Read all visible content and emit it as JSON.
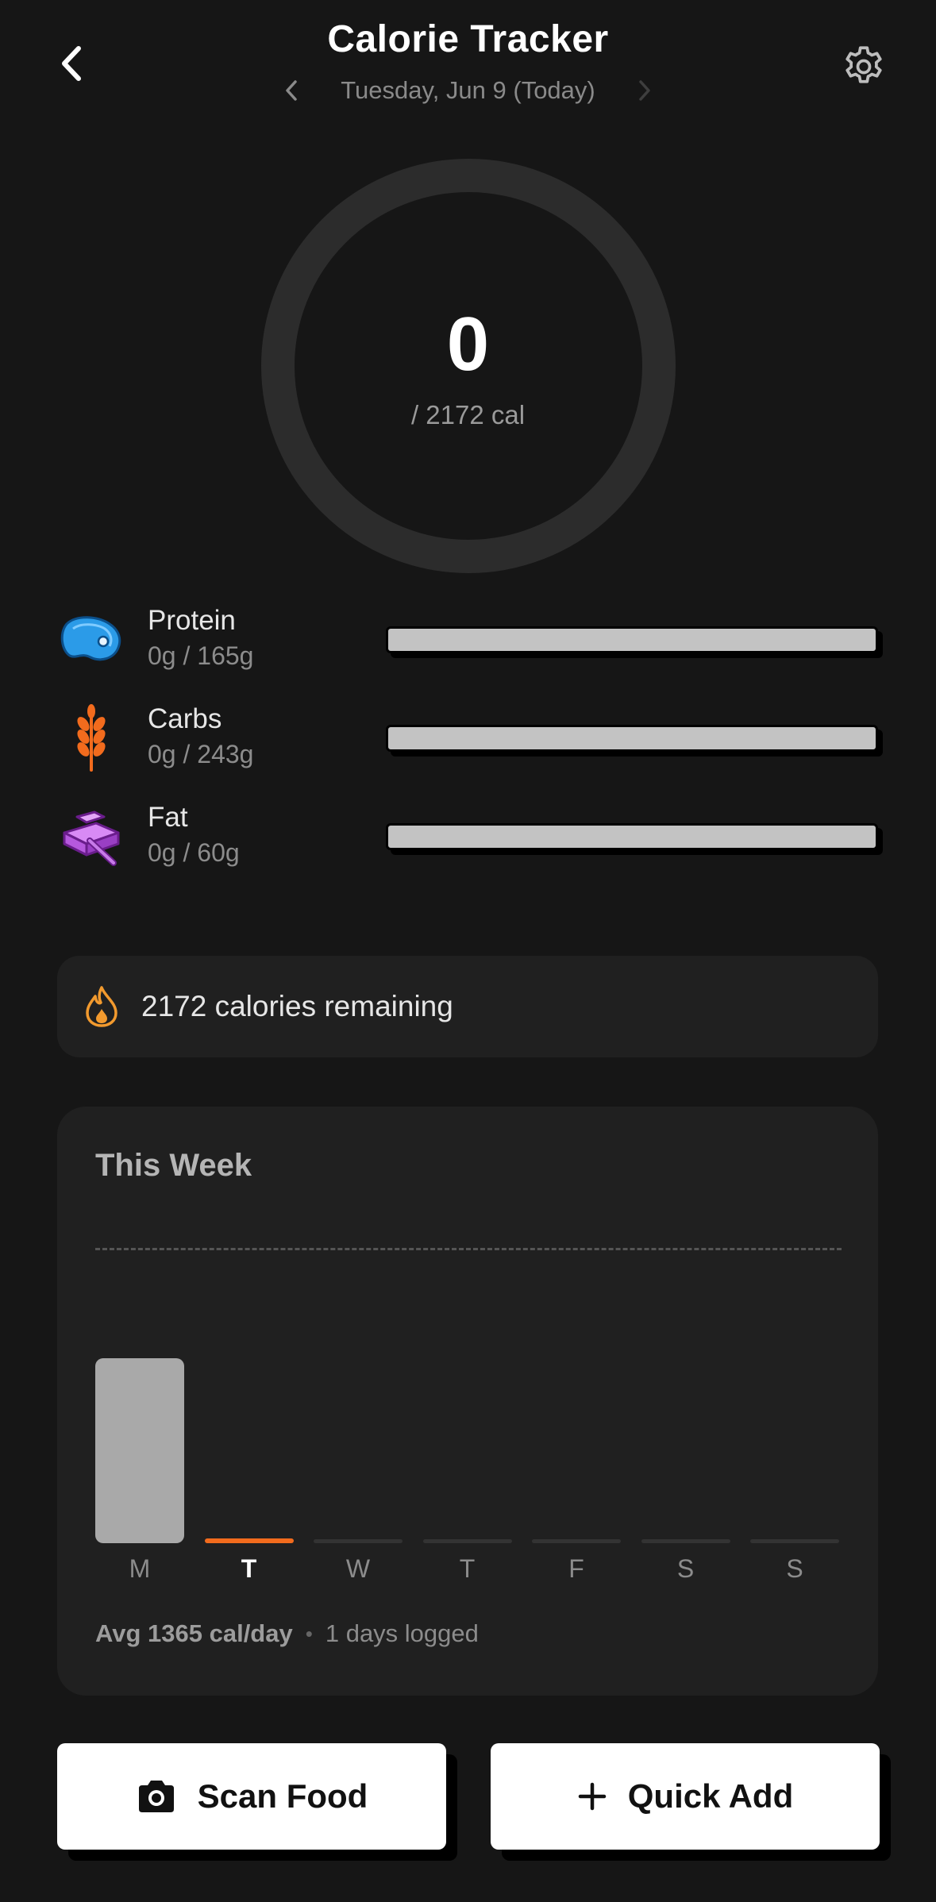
{
  "header": {
    "title": "Calorie Tracker",
    "date": "Tuesday, Jun 9 (Today)"
  },
  "ring": {
    "value": "0",
    "goal_text": "/ 2172 cal",
    "progress": 0,
    "track_color": "#2c2c2c"
  },
  "macros": [
    {
      "name": "Protein",
      "amount": "0g / 165g",
      "progress": 0,
      "icon": "steak-icon",
      "color": "#2b9be8"
    },
    {
      "name": "Carbs",
      "amount": "0g / 243g",
      "progress": 0,
      "icon": "wheat-icon",
      "color": "#f26b1d"
    },
    {
      "name": "Fat",
      "amount": "0g / 60g",
      "progress": 0,
      "icon": "butter-icon",
      "color": "#c065e6"
    }
  ],
  "remaining": {
    "text": "2172 calories remaining",
    "icon": "flame-icon",
    "color": "#f29a2e"
  },
  "week": {
    "title": "This Week",
    "days": [
      {
        "label": "M",
        "active": false
      },
      {
        "label": "T",
        "active": true
      },
      {
        "label": "W",
        "active": false
      },
      {
        "label": "T",
        "active": false
      },
      {
        "label": "F",
        "active": false
      },
      {
        "label": "S",
        "active": false
      },
      {
        "label": "S",
        "active": false
      }
    ],
    "avg": "Avg 1365 cal/day",
    "separator": "•",
    "logged": "1 days logged"
  },
  "chart_data": {
    "type": "bar",
    "categories": [
      "M",
      "T",
      "W",
      "T",
      "F",
      "S",
      "S"
    ],
    "values": [
      1365,
      0,
      0,
      0,
      0,
      0,
      0
    ],
    "goal_line": 2172,
    "grid": false,
    "colors": {
      "logged": "#a9a9a9",
      "today": "#f26b1d",
      "empty": "#333333"
    }
  },
  "actions": {
    "scan_label": "Scan Food",
    "quick_label": "Quick Add"
  }
}
